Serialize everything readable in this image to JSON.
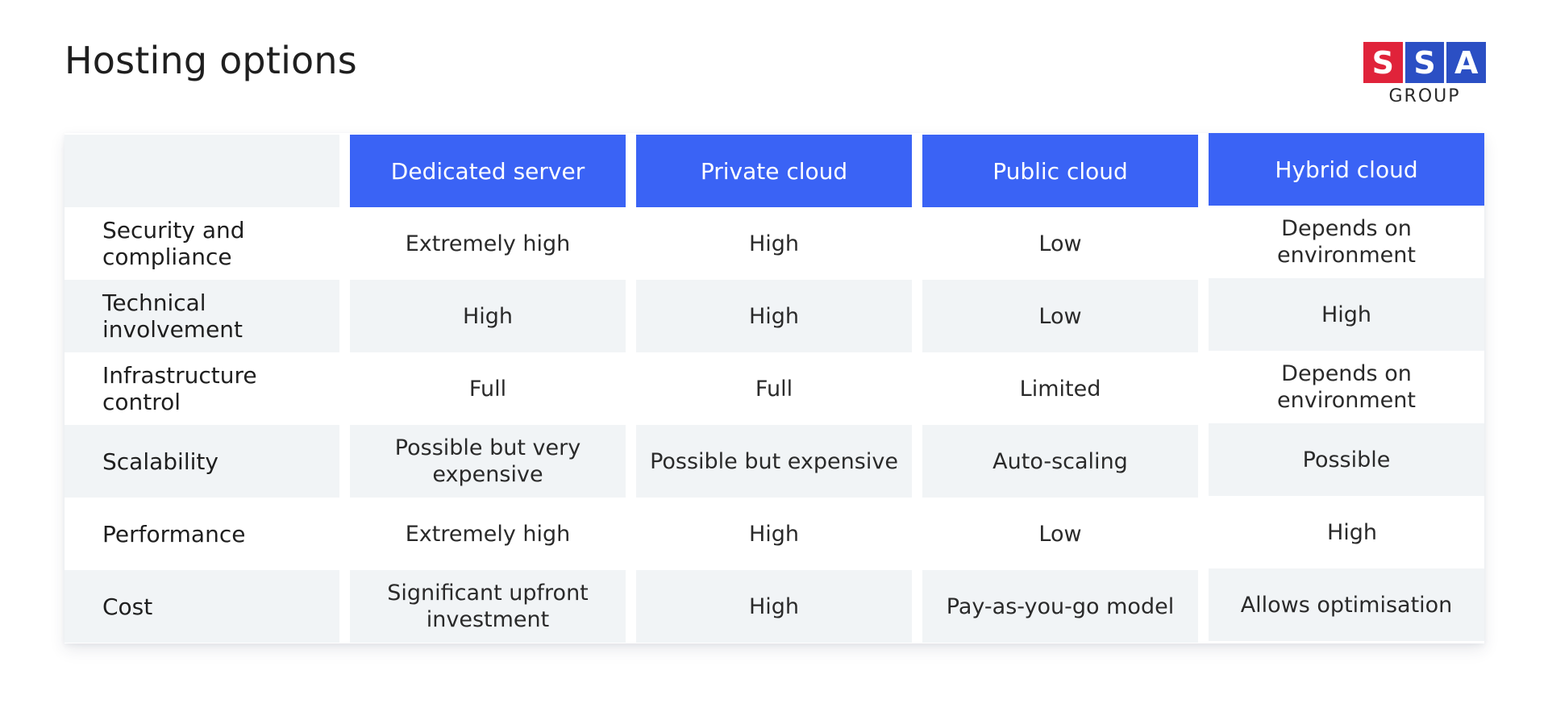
{
  "title": "Hosting options",
  "logo": {
    "letters": [
      "S",
      "S",
      "A"
    ],
    "subtitle": "GROUP",
    "colors": {
      "red": "#e0233a",
      "blue": "#2b4fc4"
    }
  },
  "colors": {
    "header_blue": "#3a63f5",
    "row_alt": "#f1f4f6"
  },
  "table": {
    "columns": [
      "Dedicated server",
      "Private cloud",
      "Public cloud",
      "Hybrid cloud"
    ],
    "rows": [
      {
        "label": "Security and compliance",
        "values": [
          "Extremely high",
          "High",
          "Low",
          "Depends on environment"
        ]
      },
      {
        "label": "Technical involvement",
        "values": [
          "High",
          "High",
          "Low",
          "High"
        ]
      },
      {
        "label": "Infrastructure control",
        "values": [
          "Full",
          "Full",
          "Limited",
          "Depends on environment"
        ]
      },
      {
        "label": "Scalability",
        "values": [
          "Possible but very expensive",
          "Possible but expensive",
          "Auto-scaling",
          "Possible"
        ]
      },
      {
        "label": "Performance",
        "values": [
          "Extremely high",
          "High",
          "Low",
          "High"
        ]
      },
      {
        "label": "Cost",
        "values": [
          "Significant upfront investment",
          "High",
          "Pay-as-you-go model",
          "Allows optimisation"
        ]
      }
    ]
  }
}
